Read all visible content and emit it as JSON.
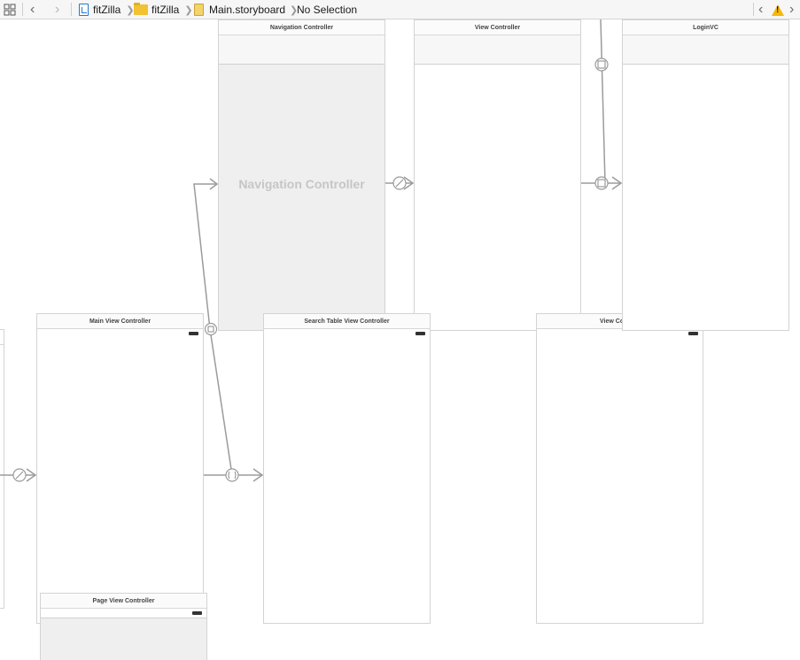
{
  "jumpbar": {
    "breadcrumb": [
      {
        "label": "fitZilla",
        "icon": "project-file-icon"
      },
      {
        "label": "fitZilla",
        "icon": "folder-icon"
      },
      {
        "label": "Main.storyboard",
        "icon": "storyboard-file-icon"
      },
      {
        "label": "No Selection",
        "icon": ""
      }
    ],
    "warning_icon": "warning-icon"
  },
  "scenes": {
    "navigation_controller": {
      "title": "Navigation Controller",
      "placeholder": "Navigation Controller"
    },
    "view_controller": {
      "title": "View Controller"
    },
    "login_vc": {
      "title": "LoginVC"
    },
    "main_view_controller": {
      "title": "Main View Controller"
    },
    "search_table_view_controller": {
      "title": "Search Table View Controller"
    },
    "view_controller_2": {
      "title": "View Co"
    },
    "page_view_controller": {
      "title": "Page View Controller"
    }
  },
  "colors": {
    "accent": "#1f7ad1",
    "folder": "#f1c232",
    "warning": "#f5b80c",
    "segue": "#9b9b9b"
  }
}
